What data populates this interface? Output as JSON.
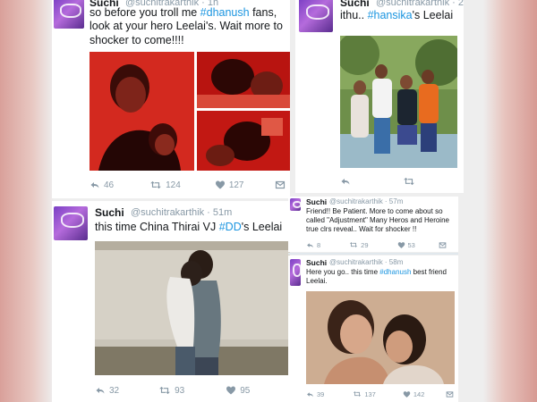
{
  "tweets": {
    "t1": {
      "name": "Suchi",
      "handle": "@suchitrakarthik · 1h",
      "text_before": "so before you troll me ",
      "hashtag": "#dhanush",
      "text_after": " fans, look at your hero Leelai's. Wait more to shocker to come!!!!",
      "reply": "46",
      "retweets": "124",
      "likes": "127"
    },
    "t2": {
      "name": "Suchi",
      "handle": "@suchitrakarthik · 2",
      "text_before": "ithu.. ",
      "hashtag": "#hansika",
      "text_after": "'s Leelai"
    },
    "t3": {
      "name": "Suchi",
      "handle": "@suchitrakarthik · 51m",
      "text_before": "this time China Thirai VJ ",
      "hashtag": "#DD",
      "text_after": "'s Leelai",
      "reply": "32",
      "retweets": "93",
      "likes": "95"
    },
    "t4": {
      "name": "Suchi",
      "handle": "@suchitrakarthik · 57m",
      "text": "Friend!! Be Patient. More to come about so called \"Adjustment\" Many Heros and Heroine true clrs reveal.. Wait for shocker !!",
      "reply": "8",
      "retweets": "29",
      "likes": "53"
    },
    "t5": {
      "name": "Suchi",
      "handle": "@suchitrakarthik · 58m",
      "text_before": "Here you go.. this time ",
      "hashtag": "#dhanush",
      "text_after": " best friend Leelai.",
      "reply": "39",
      "retweets": "137",
      "likes": "142"
    }
  },
  "icons": [
    "reply-icon",
    "retweet-icon",
    "like-icon",
    "direct-message-icon",
    "avatar-heart-glasses"
  ],
  "colors": {
    "hashtag": "#1b95e0",
    "meta": "#8899a6",
    "text": "#14171a"
  }
}
